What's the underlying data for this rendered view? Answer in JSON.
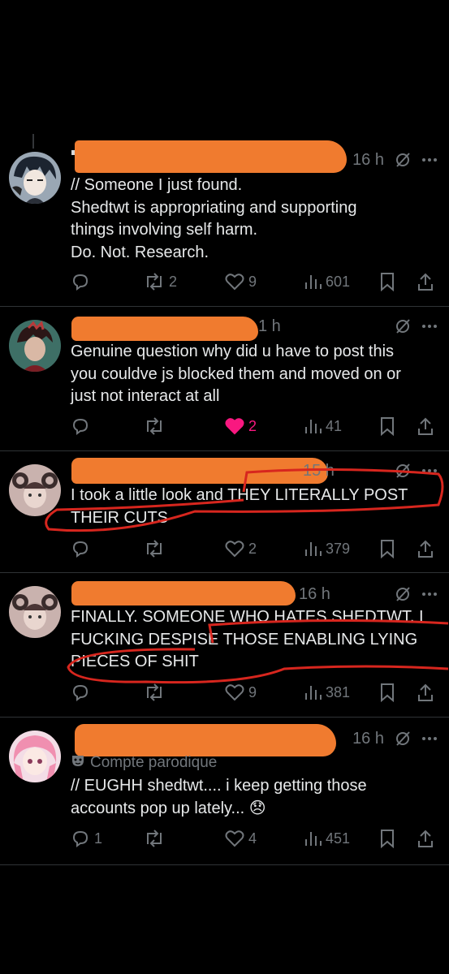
{
  "tweets": [
    {
      "time": "16 h",
      "text": "// Someone I just found.\nShedtwt is appropriating and supporting\nthings involving self harm.\nDo. Not. Research.",
      "replies": "",
      "reposts": "2",
      "likes": "9",
      "views": "601",
      "liked": false
    },
    {
      "time": "1 h",
      "text": "Genuine question why did u have to post this\nyou couldve js blocked them and moved on or\njust not interact at all",
      "replies": "",
      "reposts": "",
      "likes": "2",
      "views": "41",
      "liked": true
    },
    {
      "time": "15 h",
      "text": "I took a little look and THEY LITERALLY POST\nTHEIR CUTS",
      "replies": "",
      "reposts": "",
      "likes": "2",
      "views": "379",
      "liked": false
    },
    {
      "time": "16 h",
      "text": "FINALLY. SOMEONE WHO HATES SHEDTWT. I\nFUCKING DESPISE THOSE ENABLING LYING\nPIECES OF SHIT",
      "replies": "",
      "reposts": "",
      "likes": "9",
      "views": "381",
      "liked": false
    },
    {
      "time": "16 h",
      "parody_label": "Compte parodique",
      "text": "// EUGHH shedtwt.... i keep getting those\naccounts pop up lately... 😞",
      "replies": "1",
      "reposts": "",
      "likes": "4",
      "views": "451",
      "liked": false
    }
  ],
  "icons": {
    "reply": "reply-icon",
    "repost": "repost-icon",
    "like": "heart-icon",
    "views": "views-icon",
    "bookmark": "bookmark-icon",
    "share": "share-icon",
    "grok": "grok-icon",
    "more": "more-icon"
  },
  "colors": {
    "background": "#000000",
    "text": "#e7e9ea",
    "muted": "#71767b",
    "like_active": "#f91880",
    "redaction": "#f07b2f",
    "scribble": "#d7261e"
  }
}
